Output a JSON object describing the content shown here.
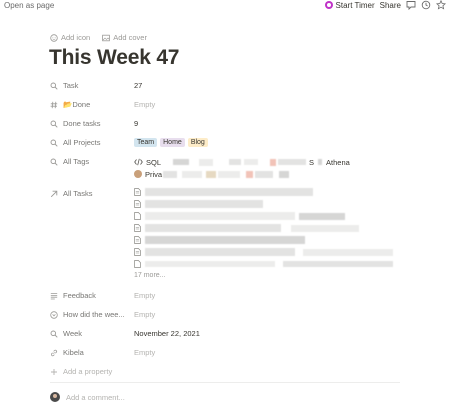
{
  "topbar": {
    "open_as_page": "Open as page",
    "start_timer": "Start Timer",
    "share": "Share",
    "timer_color": "#c032c8",
    "icons": [
      "comment-icon",
      "clock-icon",
      "star-icon"
    ]
  },
  "meta": {
    "add_icon": "Add icon",
    "add_cover": "Add cover"
  },
  "title": "This Week 47",
  "props": {
    "task": {
      "name": "Task",
      "value": "27"
    },
    "done": {
      "name": "📂Done",
      "value": "Empty"
    },
    "done_tasks": {
      "name": "Done tasks",
      "value": "9"
    },
    "all_projects": {
      "name": "All Projects",
      "tags": [
        "Team",
        "Home",
        "Blog"
      ]
    },
    "all_tags": {
      "name": "All Tags",
      "tag_sql": "SQL",
      "tag_s": "S",
      "tag_athena": "Athena",
      "tag_priv": "Priva"
    },
    "all_tasks": {
      "name": "All Tasks",
      "more": "17 more..."
    },
    "feedback": {
      "name": "Feedback",
      "value": "Empty"
    },
    "how_did": {
      "name": "How did the wee...",
      "value": "Empty"
    },
    "week": {
      "name": "Week",
      "value": "November 22, 2021"
    },
    "kibela": {
      "name": "Kibela",
      "value": "Empty"
    },
    "add_property": "Add a property"
  },
  "comment": {
    "placeholder": "Add a comment..."
  }
}
